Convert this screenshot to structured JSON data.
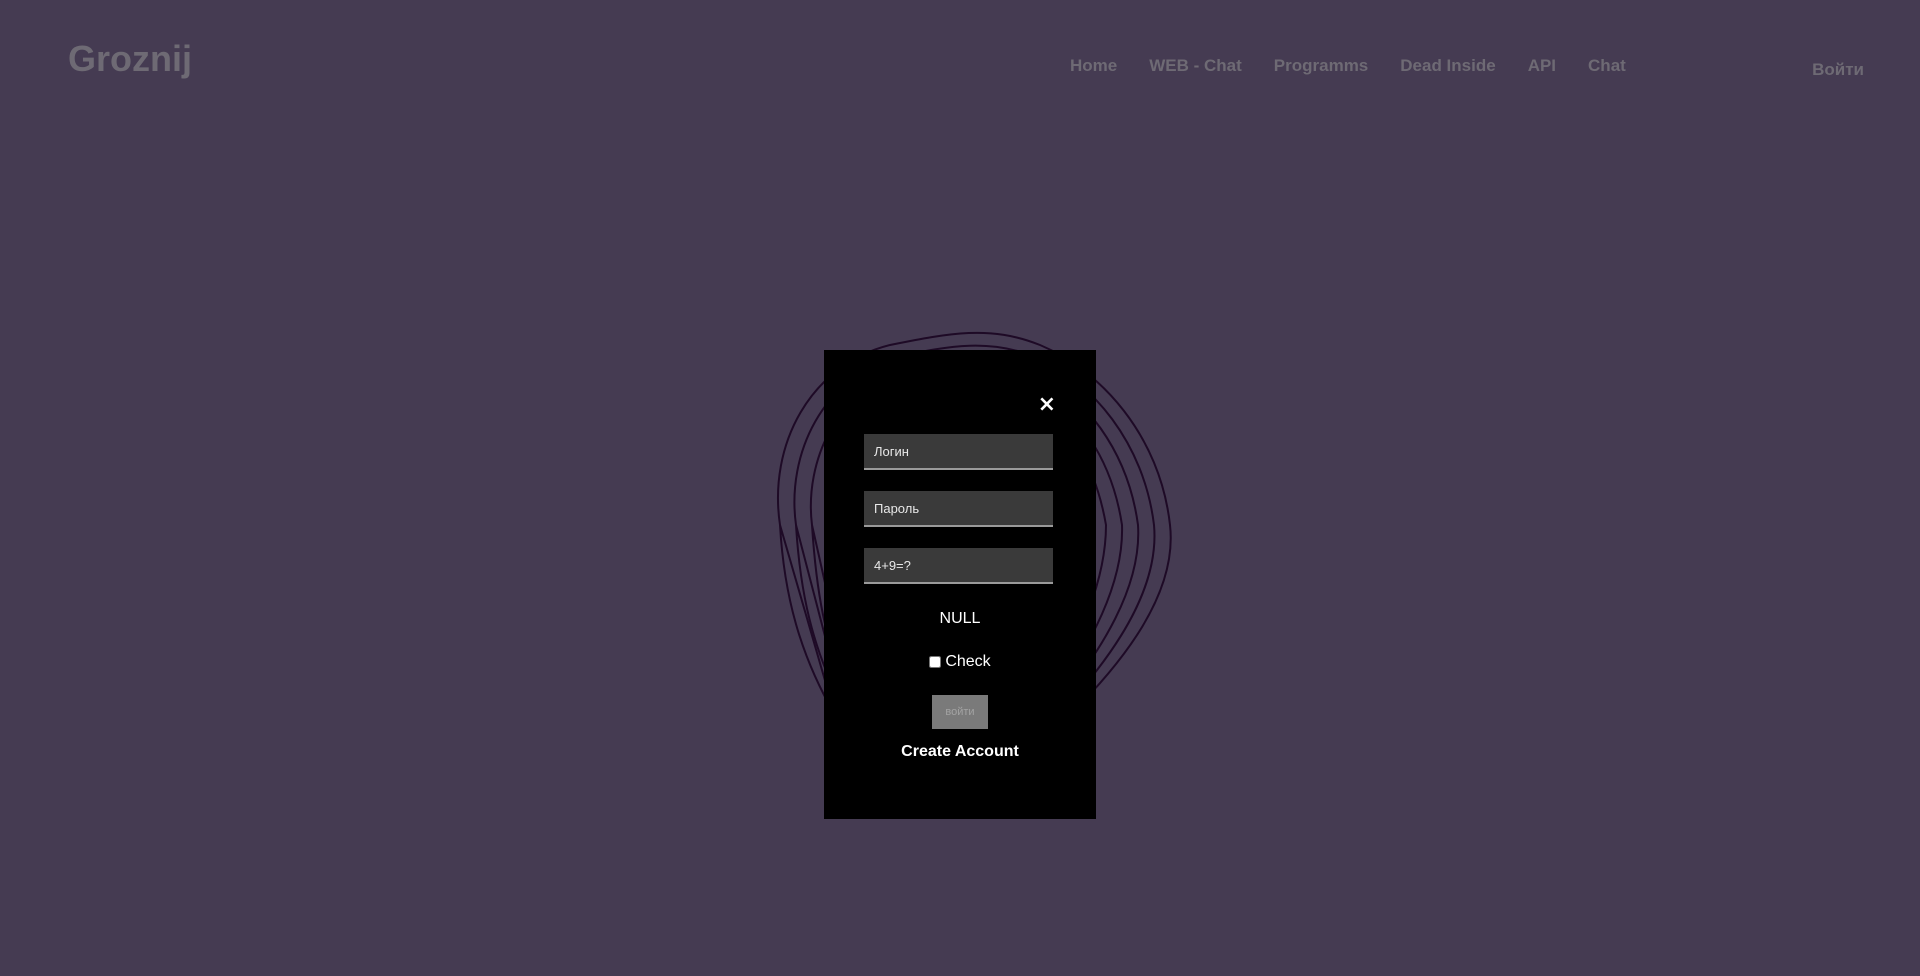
{
  "header": {
    "logo": "Groznij",
    "nav": [
      "Home",
      "WEB - Chat",
      "Programms",
      "Dead Inside",
      "API",
      "Chat"
    ],
    "login": "Войти"
  },
  "modal": {
    "close_icon": "×",
    "login_placeholder": "Логин",
    "password_placeholder": "Пароль",
    "captcha_placeholder": "4+9=?",
    "status": "NULL",
    "check_label": "Check",
    "submit_label": "войти",
    "create_account": "Create Account"
  },
  "colors": {
    "background": "#453b52",
    "modal": "#000000",
    "ring": "#2a0e33"
  }
}
